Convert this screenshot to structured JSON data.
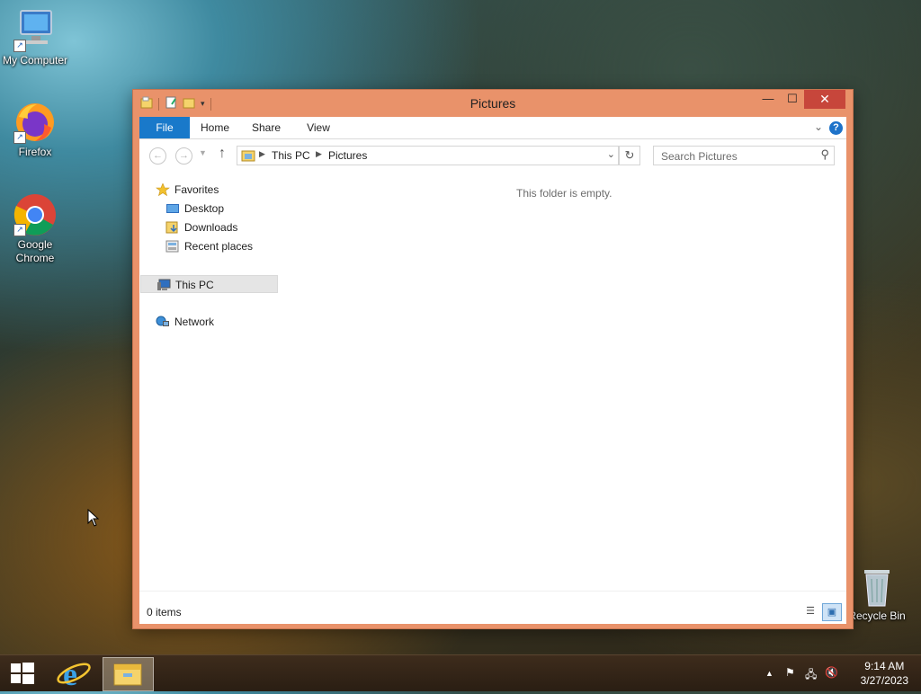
{
  "desktop": {
    "icons": [
      {
        "label": "My Computer",
        "icon": "my-computer-icon"
      },
      {
        "label": "Firefox",
        "icon": "firefox-icon"
      },
      {
        "label": "Google Chrome",
        "icon": "chrome-icon"
      },
      {
        "label": "Recycle Bin",
        "icon": "recycle-bin-icon"
      }
    ]
  },
  "window": {
    "title": "Pictures",
    "ribbon_tabs": [
      "File",
      "Home",
      "Share",
      "View"
    ],
    "address": {
      "crumbs": [
        "This PC",
        "Pictures"
      ]
    },
    "search": {
      "placeholder": "Search Pictures"
    },
    "nav_pane": {
      "favorites": "Favorites",
      "favorites_items": [
        "Desktop",
        "Downloads",
        "Recent places"
      ],
      "this_pc": "This PC",
      "network": "Network"
    },
    "empty_message": "This folder is empty.",
    "status": {
      "item_count": "0 items"
    }
  },
  "taskbar": {
    "time": "9:14 AM",
    "date": "3/27/2023"
  },
  "colors": {
    "window_frame": "#e9926a",
    "file_tab": "#1979ca",
    "close_button": "#c7463b"
  }
}
